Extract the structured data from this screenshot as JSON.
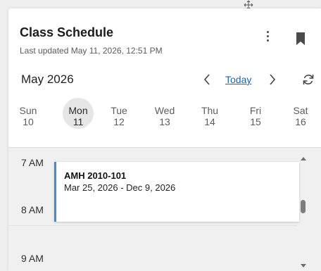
{
  "header": {
    "title": "Class Schedule",
    "last_updated": "Last updated May 11, 2026, 12:51 PM"
  },
  "nav": {
    "month_label": "May 2026",
    "today_label": "Today"
  },
  "week": {
    "days": [
      {
        "name": "Sun",
        "num": "10"
      },
      {
        "name": "Mon",
        "num": "11"
      },
      {
        "name": "Tue",
        "num": "12"
      },
      {
        "name": "Wed",
        "num": "13"
      },
      {
        "name": "Thu",
        "num": "14"
      },
      {
        "name": "Fri",
        "num": "15"
      },
      {
        "name": "Sat",
        "num": "16"
      }
    ],
    "selected_day": "Mon"
  },
  "timeline": {
    "hours": [
      "7 AM",
      "8 AM",
      "9 AM"
    ],
    "event": {
      "title": "AMH 2010-101",
      "dates": "Mar 25, 2026 - Dec 9, 2026"
    }
  },
  "icons": {
    "menu": "more-vertical-icon",
    "bookmark": "bookmark-icon",
    "prev": "chevron-left-icon",
    "next": "chevron-right-icon",
    "refresh": "refresh-icon"
  },
  "colors": {
    "accent": "#3b8fe0",
    "link": "#1565c0",
    "selected_day_bg": "#e6e6e6"
  }
}
